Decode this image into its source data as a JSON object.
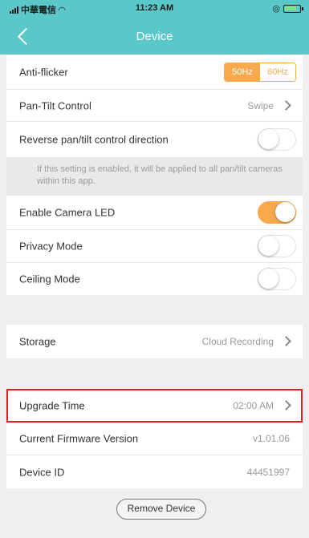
{
  "status": {
    "carrier": "中華電信",
    "time": "11:23 AM"
  },
  "nav": {
    "title": "Device"
  },
  "anti_flicker": {
    "label": "Anti-flicker",
    "option_a": "50Hz",
    "option_b": "60Hz",
    "selected": "50Hz"
  },
  "pan_tilt": {
    "label": "Pan-Tilt Control",
    "value": "Swipe"
  },
  "reverse": {
    "label": "Reverse pan/tilt control direction",
    "enabled": false
  },
  "reverse_note": "If this setting is enabled, it will be applied to all pan/tilt cameras within this app.",
  "camera_led": {
    "label": "Enable Camera LED",
    "enabled": true
  },
  "privacy": {
    "label": "Privacy Mode",
    "enabled": false
  },
  "ceiling": {
    "label": "Ceiling Mode",
    "enabled": false
  },
  "storage": {
    "label": "Storage",
    "value": "Cloud Recording"
  },
  "upgrade": {
    "label": "Upgrade Time",
    "value": "02:00 AM"
  },
  "firmware": {
    "label": "Current Firmware Version",
    "value": "v1.01.06"
  },
  "device_id": {
    "label": "Device ID",
    "value": "44451997"
  },
  "remove_button": "Remove Device",
  "colors": {
    "nav_bg": "#5ac7c9",
    "accent": "#f7a94b",
    "highlight": "#e02020"
  }
}
